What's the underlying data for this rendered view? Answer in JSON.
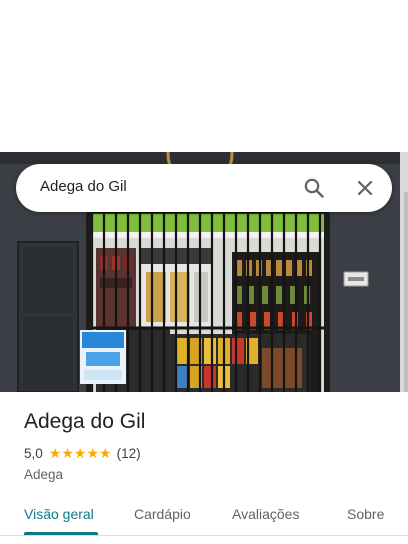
{
  "search": {
    "query": "Adega do Gil"
  },
  "place": {
    "name": "Adega do Gil",
    "rating": "5,0",
    "stars": 5,
    "review_count": "(12)",
    "category": "Adega"
  },
  "tabs": [
    {
      "label": "Visão geral",
      "active": true
    },
    {
      "label": "Cardápio",
      "active": false
    },
    {
      "label": "Avaliações",
      "active": false
    },
    {
      "label": "Sobre",
      "active": false
    }
  ],
  "colors": {
    "accent": "#0b7a86",
    "star": "#f9ab00"
  },
  "icons": {
    "search": "search-icon",
    "close": "close-icon"
  }
}
